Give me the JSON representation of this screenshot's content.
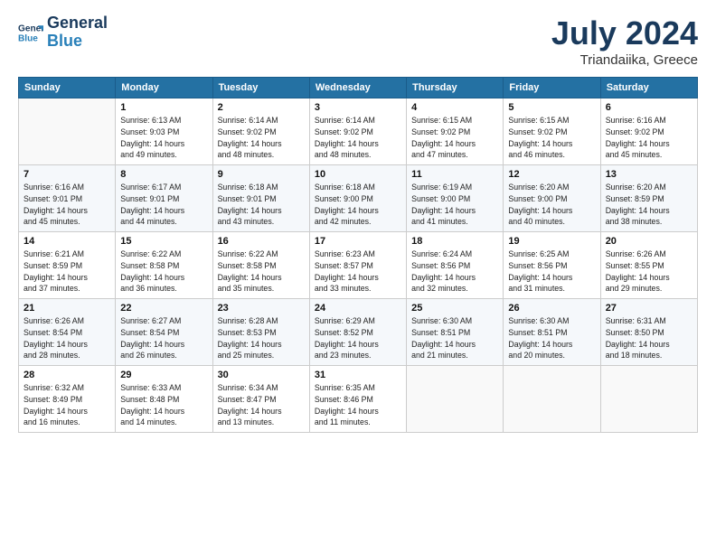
{
  "header": {
    "logo_line1": "General",
    "logo_line2": "Blue",
    "month": "July 2024",
    "location": "Triandaiika, Greece"
  },
  "columns": [
    "Sunday",
    "Monday",
    "Tuesday",
    "Wednesday",
    "Thursday",
    "Friday",
    "Saturday"
  ],
  "weeks": [
    [
      {
        "day": "",
        "info": ""
      },
      {
        "day": "1",
        "info": "Sunrise: 6:13 AM\nSunset: 9:03 PM\nDaylight: 14 hours\nand 49 minutes."
      },
      {
        "day": "2",
        "info": "Sunrise: 6:14 AM\nSunset: 9:02 PM\nDaylight: 14 hours\nand 48 minutes."
      },
      {
        "day": "3",
        "info": "Sunrise: 6:14 AM\nSunset: 9:02 PM\nDaylight: 14 hours\nand 48 minutes."
      },
      {
        "day": "4",
        "info": "Sunrise: 6:15 AM\nSunset: 9:02 PM\nDaylight: 14 hours\nand 47 minutes."
      },
      {
        "day": "5",
        "info": "Sunrise: 6:15 AM\nSunset: 9:02 PM\nDaylight: 14 hours\nand 46 minutes."
      },
      {
        "day": "6",
        "info": "Sunrise: 6:16 AM\nSunset: 9:02 PM\nDaylight: 14 hours\nand 45 minutes."
      }
    ],
    [
      {
        "day": "7",
        "info": "Sunrise: 6:16 AM\nSunset: 9:01 PM\nDaylight: 14 hours\nand 45 minutes."
      },
      {
        "day": "8",
        "info": "Sunrise: 6:17 AM\nSunset: 9:01 PM\nDaylight: 14 hours\nand 44 minutes."
      },
      {
        "day": "9",
        "info": "Sunrise: 6:18 AM\nSunset: 9:01 PM\nDaylight: 14 hours\nand 43 minutes."
      },
      {
        "day": "10",
        "info": "Sunrise: 6:18 AM\nSunset: 9:00 PM\nDaylight: 14 hours\nand 42 minutes."
      },
      {
        "day": "11",
        "info": "Sunrise: 6:19 AM\nSunset: 9:00 PM\nDaylight: 14 hours\nand 41 minutes."
      },
      {
        "day": "12",
        "info": "Sunrise: 6:20 AM\nSunset: 9:00 PM\nDaylight: 14 hours\nand 40 minutes."
      },
      {
        "day": "13",
        "info": "Sunrise: 6:20 AM\nSunset: 8:59 PM\nDaylight: 14 hours\nand 38 minutes."
      }
    ],
    [
      {
        "day": "14",
        "info": "Sunrise: 6:21 AM\nSunset: 8:59 PM\nDaylight: 14 hours\nand 37 minutes."
      },
      {
        "day": "15",
        "info": "Sunrise: 6:22 AM\nSunset: 8:58 PM\nDaylight: 14 hours\nand 36 minutes."
      },
      {
        "day": "16",
        "info": "Sunrise: 6:22 AM\nSunset: 8:58 PM\nDaylight: 14 hours\nand 35 minutes."
      },
      {
        "day": "17",
        "info": "Sunrise: 6:23 AM\nSunset: 8:57 PM\nDaylight: 14 hours\nand 33 minutes."
      },
      {
        "day": "18",
        "info": "Sunrise: 6:24 AM\nSunset: 8:56 PM\nDaylight: 14 hours\nand 32 minutes."
      },
      {
        "day": "19",
        "info": "Sunrise: 6:25 AM\nSunset: 8:56 PM\nDaylight: 14 hours\nand 31 minutes."
      },
      {
        "day": "20",
        "info": "Sunrise: 6:26 AM\nSunset: 8:55 PM\nDaylight: 14 hours\nand 29 minutes."
      }
    ],
    [
      {
        "day": "21",
        "info": "Sunrise: 6:26 AM\nSunset: 8:54 PM\nDaylight: 14 hours\nand 28 minutes."
      },
      {
        "day": "22",
        "info": "Sunrise: 6:27 AM\nSunset: 8:54 PM\nDaylight: 14 hours\nand 26 minutes."
      },
      {
        "day": "23",
        "info": "Sunrise: 6:28 AM\nSunset: 8:53 PM\nDaylight: 14 hours\nand 25 minutes."
      },
      {
        "day": "24",
        "info": "Sunrise: 6:29 AM\nSunset: 8:52 PM\nDaylight: 14 hours\nand 23 minutes."
      },
      {
        "day": "25",
        "info": "Sunrise: 6:30 AM\nSunset: 8:51 PM\nDaylight: 14 hours\nand 21 minutes."
      },
      {
        "day": "26",
        "info": "Sunrise: 6:30 AM\nSunset: 8:51 PM\nDaylight: 14 hours\nand 20 minutes."
      },
      {
        "day": "27",
        "info": "Sunrise: 6:31 AM\nSunset: 8:50 PM\nDaylight: 14 hours\nand 18 minutes."
      }
    ],
    [
      {
        "day": "28",
        "info": "Sunrise: 6:32 AM\nSunset: 8:49 PM\nDaylight: 14 hours\nand 16 minutes."
      },
      {
        "day": "29",
        "info": "Sunrise: 6:33 AM\nSunset: 8:48 PM\nDaylight: 14 hours\nand 14 minutes."
      },
      {
        "day": "30",
        "info": "Sunrise: 6:34 AM\nSunset: 8:47 PM\nDaylight: 14 hours\nand 13 minutes."
      },
      {
        "day": "31",
        "info": "Sunrise: 6:35 AM\nSunset: 8:46 PM\nDaylight: 14 hours\nand 11 minutes."
      },
      {
        "day": "",
        "info": ""
      },
      {
        "day": "",
        "info": ""
      },
      {
        "day": "",
        "info": ""
      }
    ]
  ]
}
